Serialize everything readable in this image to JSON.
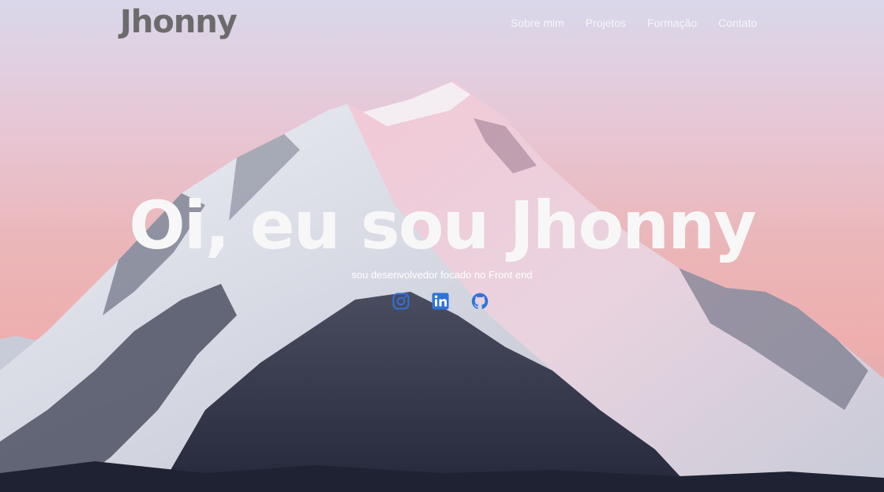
{
  "header": {
    "logo": "Jhonny",
    "nav": [
      "Sobre mim",
      "Projetos",
      "Formação",
      "Contato"
    ]
  },
  "hero": {
    "headline": "Oi, eu sou Jhonny",
    "subtitle": "sou desenvolvedor focado no Front end",
    "socials": [
      {
        "icon": "instagram-icon"
      },
      {
        "icon": "linkedin-icon"
      },
      {
        "icon": "github-icon"
      }
    ],
    "icon_color": "#2f73d9"
  }
}
